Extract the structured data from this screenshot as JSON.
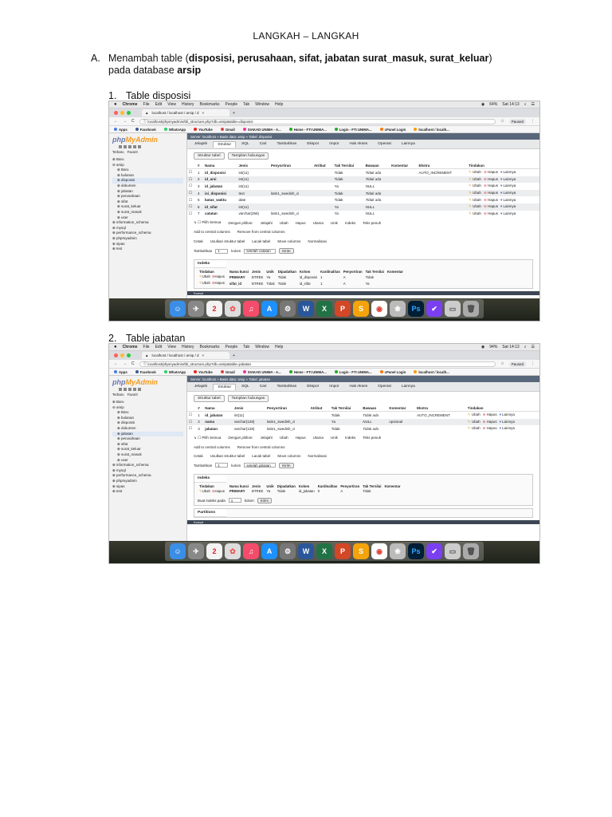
{
  "doc": {
    "title": "LANGKAH – LANGKAH",
    "section_num": "A.",
    "section_pre": "Menambah table (",
    "section_bold": "disposisi, perusahaan, sifat, jabatan surat_masuk, surat_keluar",
    "section_post": ")",
    "section_line2_pre": "pada database ",
    "section_line2_bold": "arsip",
    "sub1_num": "1.",
    "sub1_label": "Table disposisi",
    "sub2_num": "2.",
    "sub2_label": "Table jabatan"
  },
  "mac": {
    "apple": "",
    "menu": [
      "Chrome",
      "File",
      "Edit",
      "View",
      "History",
      "Bookmarks",
      "People",
      "Tab",
      "Window",
      "Help"
    ],
    "battery": "64%",
    "battery2": "94%",
    "clock": "Sat 14:13"
  },
  "browser": {
    "tab_label": "localhost / localhost / arsip / d",
    "url1": "localhost/phpmyadmin/tbl_structure.php?db=arsip&table=disposisi",
    "url2": "localhost/phpmyadmin/tbl_structure.php?db=arsip&table=jabatan",
    "paused": "Paused",
    "bookmarks": [
      "Apps",
      "Facebook",
      "WhatsApp",
      "YouTube",
      "Gmail",
      "SIAKAD UNIMA - A...",
      "Home - FTI UNIMA...",
      "Login - FTI UNIMA...",
      "cPanel Login",
      "localhost / localh..."
    ]
  },
  "pma": {
    "logo_a": "php",
    "logo_b": "MyAdmin",
    "side_tabs": [
      "Terbaru",
      "Favorit"
    ],
    "tree": [
      "Baru",
      "arsip",
      "Baru",
      "bulanan",
      "disposisi",
      "dokumen",
      "jabatan",
      "perusahaan",
      "sifat",
      "surat_keluar",
      "surat_masuk",
      "user",
      "information_schema",
      "mysql",
      "performance_schema",
      "phpmyadmin",
      "sipas",
      "test"
    ],
    "crumb1": "Server: localhost » Basis data: arsip » Tabel: disposisi",
    "crumb2": "Server: localhost » Basis data: arsip » Tabel: jabatan",
    "nav": [
      "Jelajahi",
      "Struktur",
      "SQL",
      "Cari",
      "Tambahkan",
      "Ekspor",
      "Impor",
      "Hak Akses",
      "Operasi",
      "Lainnya"
    ],
    "subtabs": [
      "Struktur tabel",
      "Tampilan hubungan"
    ],
    "col_headers": [
      "#",
      "Nama",
      "Jenis",
      "Penyortiran",
      "Atribut",
      "Tak Ternilai",
      "Bawaan",
      "Komentar",
      "Ekstra",
      "Tindakan"
    ],
    "act_ubah": "Ubah",
    "act_hapus": "Hapus",
    "act_lain": "Lainnya",
    "rows1": [
      {
        "no": "1",
        "name": "id_disposisi",
        "type": "int(11)",
        "coll": "",
        "null": "Tidak",
        "def": "Tidak ada",
        "com": "",
        "extra": "AUTO_INCREMENT"
      },
      {
        "no": "2",
        "name": "id_arsi",
        "type": "int(11)",
        "coll": "",
        "null": "Tidak",
        "def": "Tidak ada",
        "com": "",
        "extra": ""
      },
      {
        "no": "3",
        "name": "id_jabatan",
        "type": "int(11)",
        "coll": "",
        "null": "Ya",
        "def": "NULL",
        "com": "",
        "extra": ""
      },
      {
        "no": "4",
        "name": "isi_disposisi",
        "type": "text",
        "coll": "latin1_swedish_ci",
        "null": "Tidak",
        "def": "Tidak ada",
        "com": "",
        "extra": ""
      },
      {
        "no": "5",
        "name": "batas_waktu",
        "type": "date",
        "coll": "",
        "null": "Tidak",
        "def": "Tidak ada",
        "com": "",
        "extra": ""
      },
      {
        "no": "6",
        "name": "id_sifat",
        "type": "int(11)",
        "coll": "",
        "null": "Ya",
        "def": "NULL",
        "com": "",
        "extra": ""
      },
      {
        "no": "7",
        "name": "catatan",
        "type": "varchar(256)",
        "coll": "latin1_swedish_ci",
        "null": "Ya",
        "def": "NULL",
        "com": "",
        "extra": ""
      }
    ],
    "rows2": [
      {
        "no": "1",
        "name": "id_jabatan",
        "type": "int(11)",
        "coll": "",
        "null": "Tidak",
        "def": "Tidak ada",
        "com": "",
        "extra": "AUTO_INCREMENT"
      },
      {
        "no": "2",
        "name": "nama",
        "type": "varchar(128)",
        "coll": "latin1_swedish_ci",
        "null": "Ya",
        "def": "NULL",
        "com": "opsional",
        "extra": ""
      },
      {
        "no": "3",
        "name": "jabatan",
        "type": "varchar(128)",
        "coll": "latin1_swedish_ci",
        "null": "Tidak",
        "def": "Tidak ada",
        "com": "",
        "extra": ""
      }
    ],
    "tools": [
      "Pilih Semua",
      "Dengan pilihan:",
      "Jelajahi",
      "Ubah",
      "Hapus",
      "Utama",
      "Unik",
      "Indeks",
      "Teks penuh"
    ],
    "tools2": [
      "Add to central columns",
      "Remove from central columns"
    ],
    "tools3": [
      "Cetak",
      "Usulkan struktur tabel",
      "Lacak tabel",
      "Move columns",
      "Normalisasi"
    ],
    "add_label": "Tambahkan",
    "add_val": "1",
    "add_kolom": "kolom",
    "add_after1": "setelah catatan",
    "add_after2": "setelah jabatan",
    "kirim": "Kirim",
    "indeks": "Indeks",
    "idx_headers": [
      "Tindakan",
      "Nama kunci",
      "Jenis",
      "Unik",
      "Dipadatkan",
      "Kolom",
      "Kardinalitas",
      "Penyortiran",
      "Tak Ternilai",
      "Komentar"
    ],
    "idx1_rows": [
      {
        "key": "PRIMARY",
        "type": "BTREE",
        "uniq": "Ya",
        "pack": "Tidak",
        "col": "id_disposisi",
        "card": "1",
        "coll": "A",
        "null": "Tidak"
      },
      {
        "key": "sifat_id",
        "type": "BTREE",
        "uniq": "Tidak",
        "pack": "Tidak",
        "col": "id_sifat",
        "card": "1",
        "coll": "A",
        "null": "Ya"
      }
    ],
    "idx2_rows": [
      {
        "key": "PRIMARY",
        "type": "BTREE",
        "uniq": "Ya",
        "pack": "Tidak",
        "col": "id_jabatan",
        "card": "0",
        "coll": "A",
        "null": "Tidak"
      }
    ],
    "buat_indeks": "Buat indeks pada",
    "buat_val": "1",
    "kolom": "kolom",
    "partitions": "Partitions",
    "konsol": "Konsol"
  }
}
